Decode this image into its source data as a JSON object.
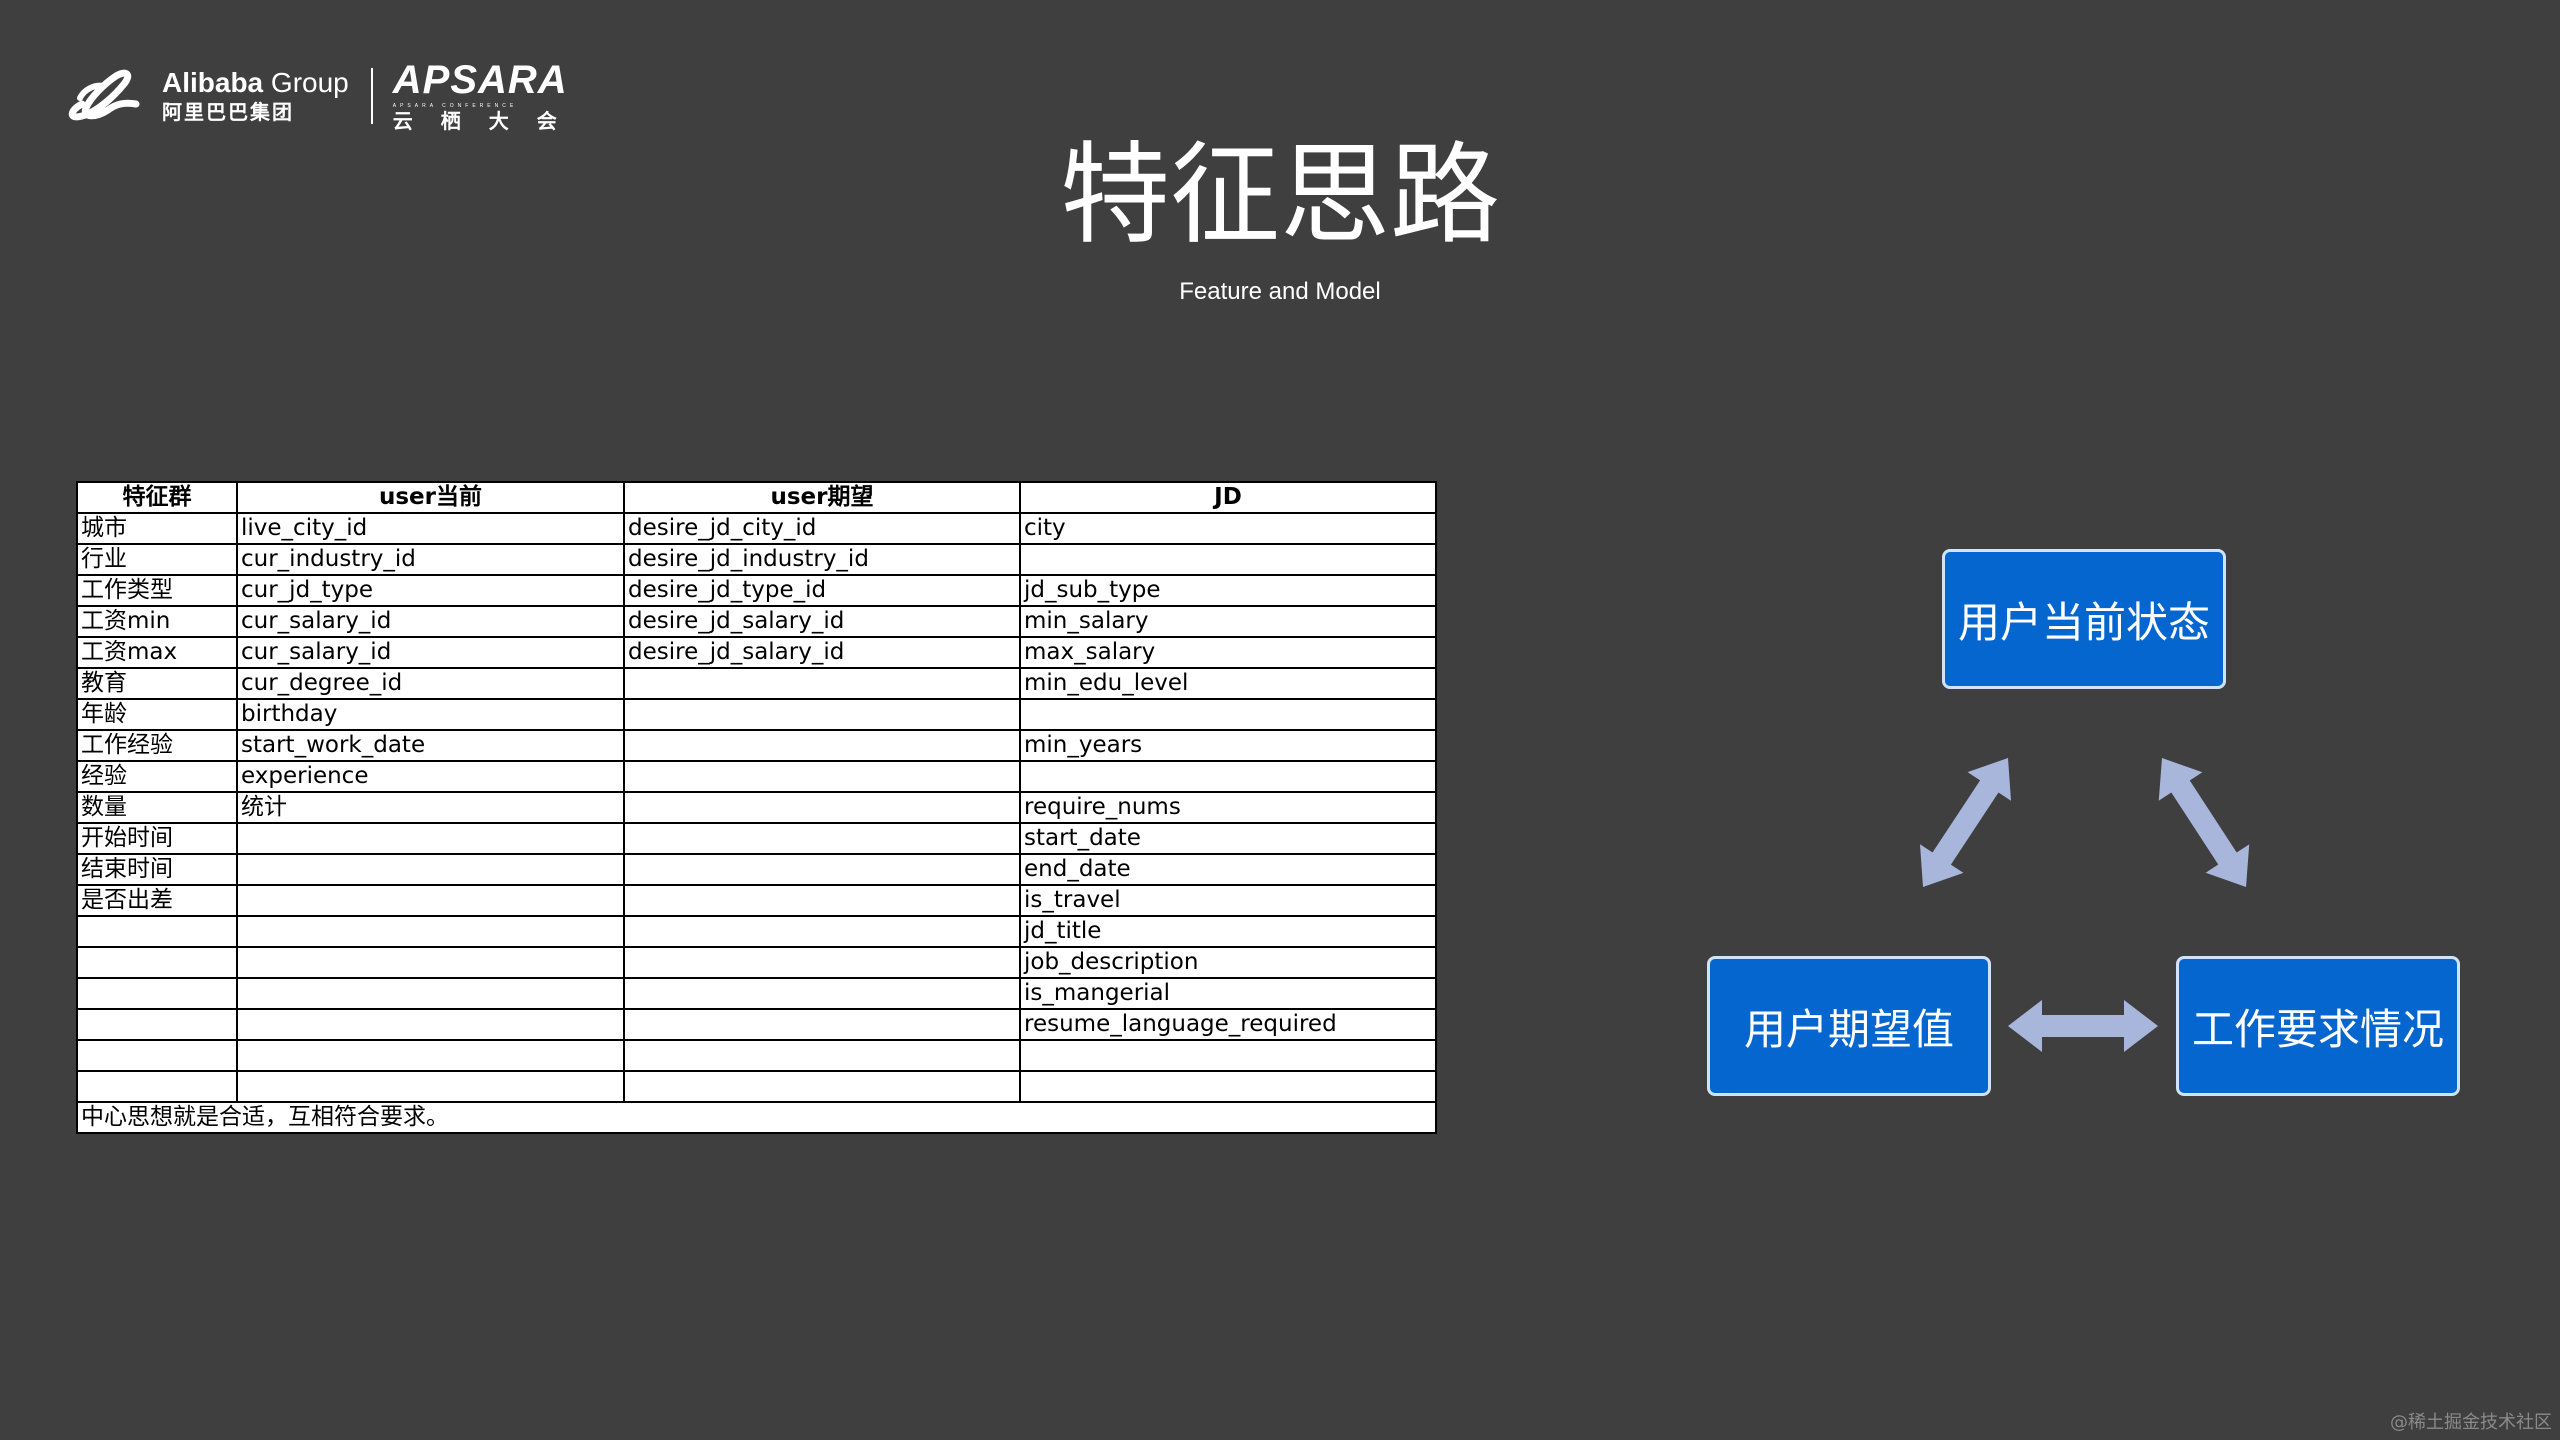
{
  "logo": {
    "brand_en_bold": "Alibaba",
    "brand_en_regular": " Group",
    "brand_cn": "阿里巴巴集团",
    "conference_name": "APSARA",
    "conference_sub": "APSARA CONFERENCE",
    "conference_cn": "云栖大会"
  },
  "title": "特征思路",
  "subtitle": "Feature and Model",
  "table": {
    "headers": [
      "特征群",
      "user当前",
      "user期望",
      "JD"
    ],
    "rows": [
      [
        "城市",
        "live_city_id",
        "desire_jd_city_id",
        "city"
      ],
      [
        "行业",
        "cur_industry_id",
        "desire_jd_industry_id",
        ""
      ],
      [
        "工作类型",
        "cur_jd_type",
        "desire_jd_type_id",
        "jd_sub_type"
      ],
      [
        "工资min",
        "cur_salary_id",
        "desire_jd_salary_id",
        "min_salary"
      ],
      [
        "工资max",
        "cur_salary_id",
        "desire_jd_salary_id",
        "max_salary"
      ],
      [
        "教育",
        "cur_degree_id",
        "",
        "min_edu_level"
      ],
      [
        "年龄",
        "birthday",
        "",
        ""
      ],
      [
        "工作经验",
        "start_work_date",
        "",
        "min_years"
      ],
      [
        "经验",
        "experience",
        "",
        ""
      ],
      [
        "数量",
        "统计",
        "",
        "require_nums"
      ],
      [
        "开始时间",
        "",
        "",
        "start_date"
      ],
      [
        "结束时间",
        "",
        "",
        "end_date"
      ],
      [
        "是否出差",
        "",
        "",
        "is_travel"
      ],
      [
        "",
        "",
        "",
        "jd_title"
      ],
      [
        "",
        "",
        "",
        "job_description"
      ],
      [
        "",
        "",
        "",
        "is_mangerial"
      ],
      [
        "",
        "",
        "",
        "resume_language_required"
      ],
      [
        "",
        "",
        "",
        ""
      ],
      [
        "",
        "",
        "",
        ""
      ]
    ],
    "note": "中心思想就是合适，互相符合要求。"
  },
  "diagram": {
    "node_top": "用户当前状态",
    "node_left": "用户期望值",
    "node_right": "工作要求情况",
    "arrow_color": "#a9b6dc",
    "box_color": "#0566cf"
  },
  "watermark": "@稀土掘金技术社区"
}
